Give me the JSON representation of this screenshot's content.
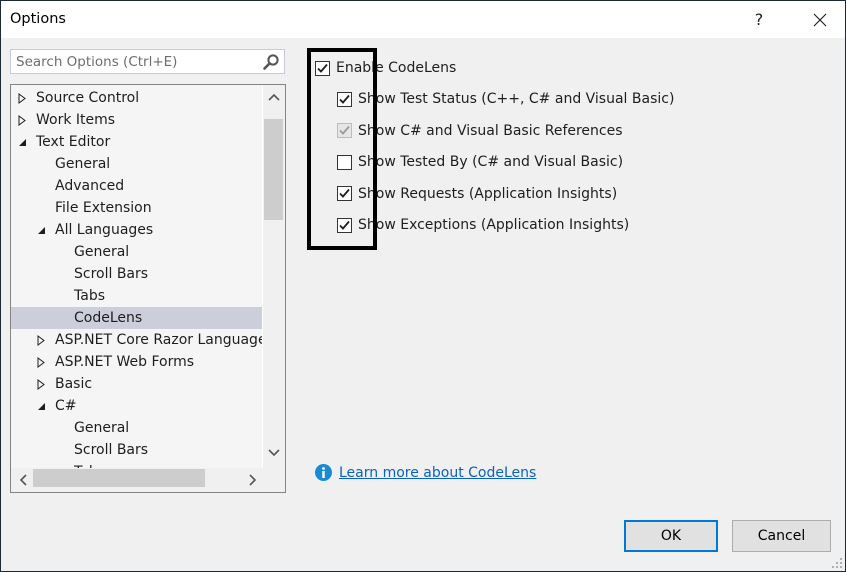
{
  "window": {
    "title": "Options",
    "help_label": "?",
    "close_label": "✕"
  },
  "search": {
    "placeholder": "Search Options (Ctrl+E)",
    "value": ""
  },
  "tree": {
    "items": [
      {
        "label": "Source Control",
        "level": 0,
        "expander": "collapsed",
        "selected": false
      },
      {
        "label": "Work Items",
        "level": 0,
        "expander": "collapsed",
        "selected": false
      },
      {
        "label": "Text Editor",
        "level": 0,
        "expander": "expanded",
        "selected": false
      },
      {
        "label": "General",
        "level": 1,
        "expander": "none",
        "selected": false
      },
      {
        "label": "Advanced",
        "level": 1,
        "expander": "none",
        "selected": false
      },
      {
        "label": "File Extension",
        "level": 1,
        "expander": "none",
        "selected": false
      },
      {
        "label": "All Languages",
        "level": 1,
        "expander": "expanded",
        "selected": false
      },
      {
        "label": "General",
        "level": 2,
        "expander": "none",
        "selected": false
      },
      {
        "label": "Scroll Bars",
        "level": 2,
        "expander": "none",
        "selected": false
      },
      {
        "label": "Tabs",
        "level": 2,
        "expander": "none",
        "selected": false
      },
      {
        "label": "CodeLens",
        "level": 2,
        "expander": "none",
        "selected": true
      },
      {
        "label": "ASP.NET Core Razor Language Services",
        "level": 1,
        "expander": "collapsed",
        "selected": false
      },
      {
        "label": "ASP.NET Web Forms",
        "level": 1,
        "expander": "collapsed",
        "selected": false
      },
      {
        "label": "Basic",
        "level": 1,
        "expander": "collapsed",
        "selected": false
      },
      {
        "label": "C#",
        "level": 1,
        "expander": "expanded",
        "selected": false
      },
      {
        "label": "General",
        "level": 2,
        "expander": "none",
        "selected": false
      },
      {
        "label": "Scroll Bars",
        "level": 2,
        "expander": "none",
        "selected": false
      },
      {
        "label": "Tabs",
        "level": 2,
        "expander": "none",
        "selected": false
      }
    ]
  },
  "codelens": {
    "enable": {
      "label": "Enable CodeLens",
      "checked": true,
      "disabled": false
    },
    "options": [
      {
        "label": "Show Test Status (C++, C# and Visual Basic)",
        "checked": true,
        "disabled": false
      },
      {
        "label": "Show C# and Visual Basic References",
        "checked": true,
        "disabled": true
      },
      {
        "label": "Show Tested By (C# and Visual Basic)",
        "checked": false,
        "disabled": false
      },
      {
        "label": "Show Requests (Application Insights)",
        "checked": true,
        "disabled": false
      },
      {
        "label": "Show Exceptions (Application Insights)",
        "checked": true,
        "disabled": false
      }
    ],
    "learn_more": "Learn more about CodeLens"
  },
  "buttons": {
    "ok": "OK",
    "cancel": "Cancel"
  },
  "colors": {
    "accent": "#0078d7",
    "link": "#0b61c6",
    "selection": "#cccedb",
    "info_icon": "#1a8ad4"
  }
}
